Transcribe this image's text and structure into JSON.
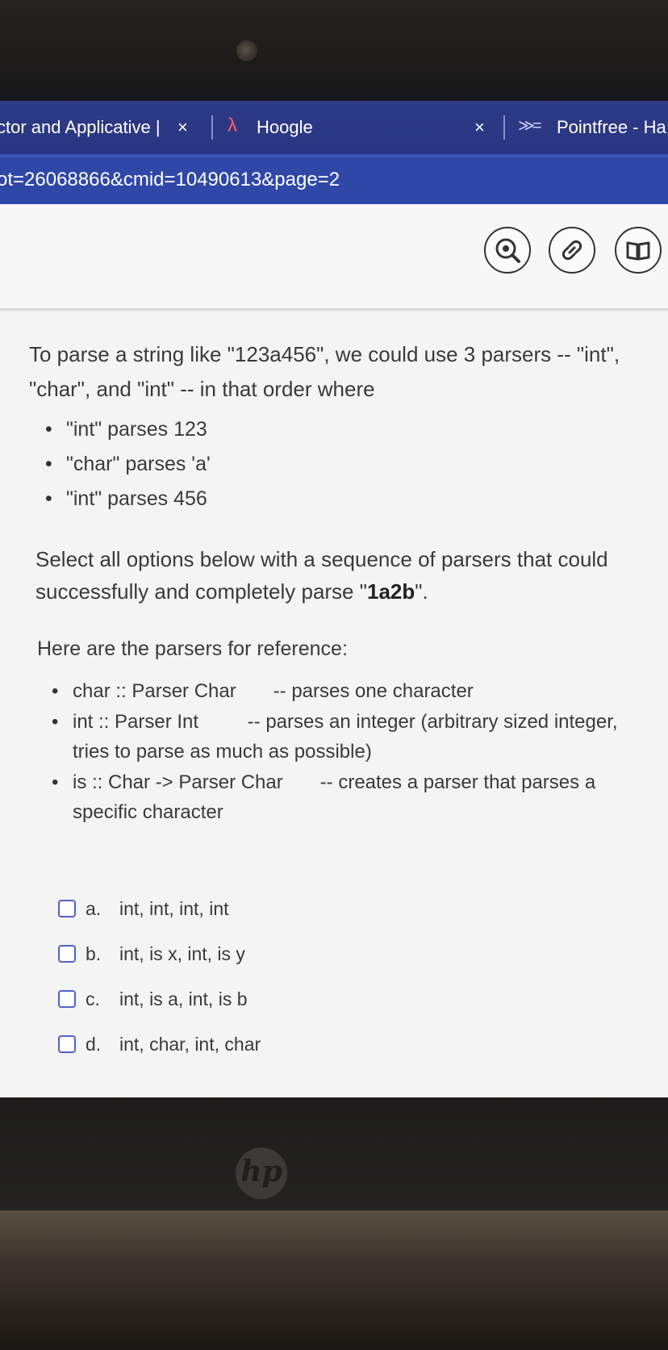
{
  "browser": {
    "tabs": [
      {
        "label": "ctor and Applicative |"
      },
      {
        "label": "Hoogle"
      },
      {
        "label": "Pointfree - Ha"
      }
    ],
    "close_glyph": "×",
    "url": "ot=26068866&cmid=10490613&page=2"
  },
  "question": {
    "intro": "To parse a string like \"123a456\", we could use 3 parsers -- \"int\", \"char\", and \"int\" -- in that order where",
    "example_bullets": [
      "\"int\" parses 123",
      "\"char\" parses 'a'",
      "\"int\" parses 456"
    ],
    "select_prefix": "Select all options below with a sequence of parsers that could successfully and completely parse \"",
    "select_bold": "1a2b",
    "select_suffix": "\".",
    "reference_heading": "Here are the parsers for reference:",
    "reference_items": [
      {
        "sig": "char :: Parser Char",
        "sep": "--",
        "desc": "parses one character"
      },
      {
        "sig": "int :: Parser Int",
        "sep": "--",
        "desc": "parses an integer (arbitrary sized integer, tries to parse as much as possible)"
      },
      {
        "sig": "is :: Char -> Parser Char",
        "sep": "--",
        "desc": "creates a parser that parses a specific character"
      }
    ],
    "options": [
      {
        "letter": "a.",
        "text": "int, int, int, int"
      },
      {
        "letter": "b.",
        "text": "int, is x, int, is y"
      },
      {
        "letter": "c.",
        "text": "int, is a, int, is b"
      },
      {
        "letter": "d.",
        "text": "int, char, int, char"
      }
    ]
  },
  "laptop": {
    "logo": "hp"
  },
  "colors": {
    "tab_bar": "#2d3a86",
    "address_bar": "#2f48a8",
    "checkbox_border": "#4f63c7",
    "hoogle_lambda": "#ff5a5a"
  },
  "icons": [
    "close-icon",
    "lambda-icon",
    "pointfree-icon",
    "eye-search-icon",
    "link-icon",
    "book-icon",
    "checkbox-icon"
  ]
}
